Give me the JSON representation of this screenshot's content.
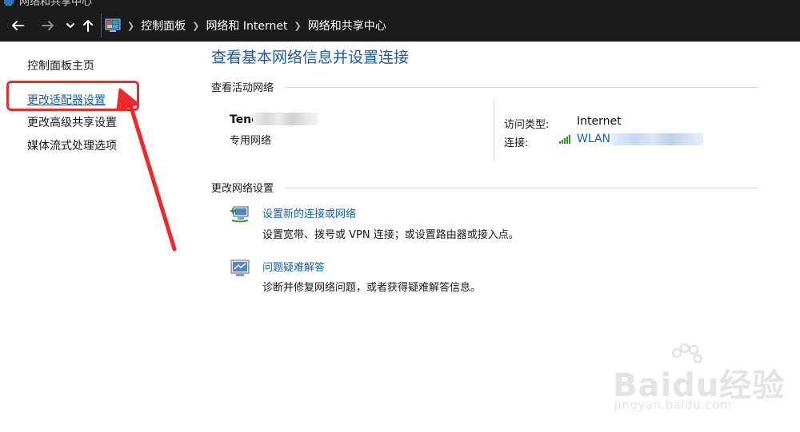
{
  "window": {
    "title": "网络和共享中心"
  },
  "nav": {
    "back_icon": "back-arrow-icon",
    "forward_icon": "forward-arrow-icon",
    "recent_icon": "chevron-down-icon",
    "up_icon": "up-arrow-icon"
  },
  "address": {
    "icon": "control-panel-icon",
    "breadcrumbs": [
      "控制面板",
      "网络和 Internet",
      "网络和共享中心"
    ]
  },
  "sidebar": {
    "items": [
      {
        "label": "控制面板主页"
      },
      {
        "label": "更改适配器设置"
      },
      {
        "label": "更改高级共享设置"
      },
      {
        "label": "媒体流式处理选项"
      }
    ],
    "highlight_color": "#f0282a"
  },
  "main": {
    "title": "查看基本网络信息并设置连接",
    "active_section": {
      "heading": "查看活动网络",
      "network_name": "Tenc",
      "network_type": "专用网络",
      "access_type_label": "访问类型:",
      "access_type_value": "Internet",
      "connection_label": "连接:",
      "connection_value": "WLAN"
    },
    "change_section": {
      "heading": "更改网络设置",
      "tasks": [
        {
          "icon": "new-connection-icon",
          "link": "设置新的连接或网络",
          "desc": "设置宽带、拨号或 VPN 连接；或设置路由器或接入点。"
        },
        {
          "icon": "troubleshoot-icon",
          "link": "问题疑难解答",
          "desc": "诊断并修复网络问题，或者获得疑难解答信息。"
        }
      ]
    }
  },
  "watermark": {
    "brand": "Baidu经验",
    "site": "jingyan.baidu.com"
  },
  "colors": {
    "link": "#1561b8",
    "title": "#1d5ba8",
    "chrome": "#1b1b1b"
  }
}
